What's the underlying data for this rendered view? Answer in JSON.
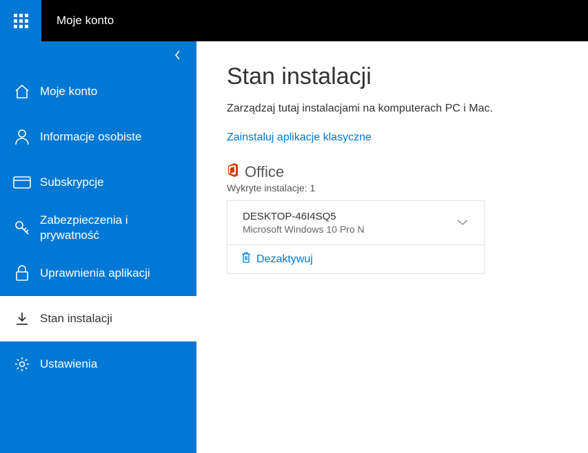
{
  "topbar": {
    "title": "Moje konto"
  },
  "sidebar": {
    "items": [
      {
        "label": "Moje konto"
      },
      {
        "label": "Informacje osobiste"
      },
      {
        "label": "Subskrypcje"
      },
      {
        "label": "Zabezpieczenia i prywatność"
      },
      {
        "label": "Uprawnienia aplikacji"
      },
      {
        "label": "Stan instalacji"
      },
      {
        "label": "Ustawienia"
      }
    ]
  },
  "main": {
    "title": "Stan instalacji",
    "description": "Zarządzaj tutaj instalacjami na komputerach PC i Mac.",
    "install_link": "Zainstaluj aplikacje klasyczne",
    "product_name": "Office",
    "detected_label": "Wykryte instalacje: 1",
    "install": {
      "name": "DESKTOP-46I4SQ5",
      "os": "Microsoft Windows 10 Pro N"
    },
    "deactivate_label": "Dezaktywuj"
  }
}
